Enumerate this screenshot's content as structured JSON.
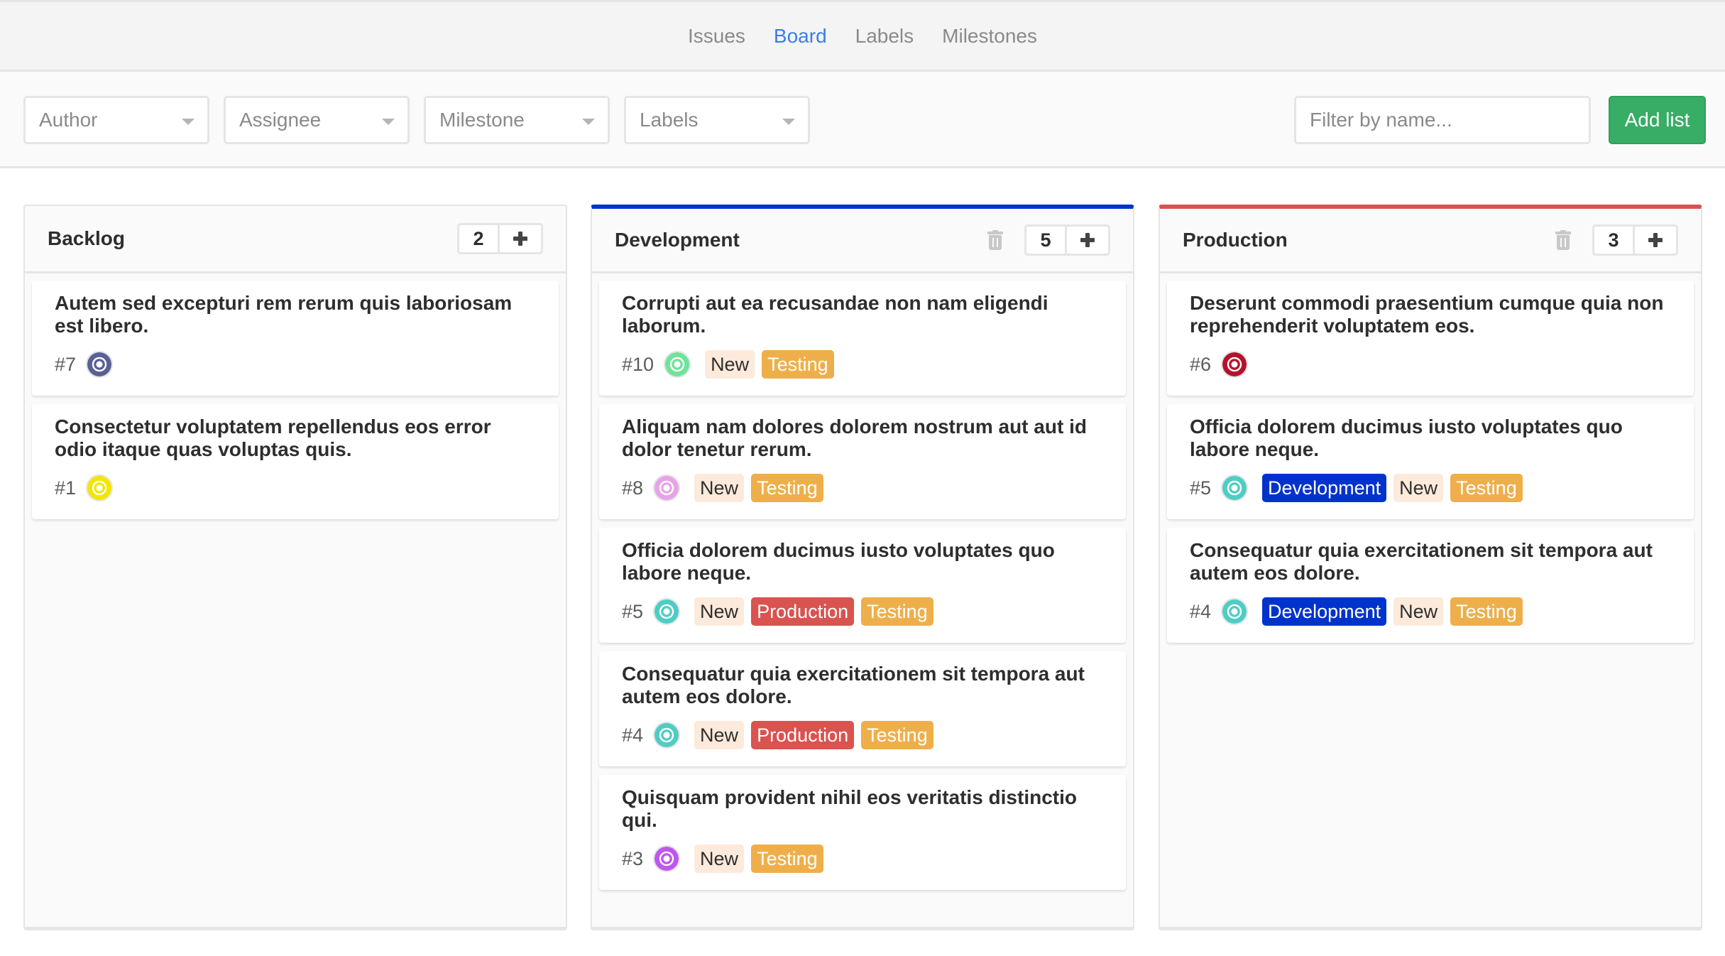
{
  "nav": {
    "items": [
      {
        "label": "Issues",
        "active": false
      },
      {
        "label": "Board",
        "active": true
      },
      {
        "label": "Labels",
        "active": false
      },
      {
        "label": "Milestones",
        "active": false
      }
    ]
  },
  "filters": {
    "author": "Author",
    "assignee": "Assignee",
    "milestone": "Milestone",
    "labels": "Labels",
    "search_placeholder": "Filter by name...",
    "search_value": "",
    "add_list_label": "Add list"
  },
  "colors": {
    "accent_link": "#3b7ee6",
    "add_list": "#37ad65",
    "development": "#0033cc",
    "production": "#d9534f",
    "new_bg": "#fdeadb",
    "new_text": "#2e2e2e",
    "testing": "#eeaf4b"
  },
  "columns": [
    {
      "title": "Backlog",
      "count": "2",
      "accent": null,
      "deletable": false,
      "cards": [
        {
          "title": "Autem sed excepturi rem rerum quis laboriosam est libero.",
          "number": "#7",
          "avatar_color": "#5a5f96",
          "labels": []
        },
        {
          "title": "Consectetur voluptatem repellendus eos error odio itaque quas voluptas quis.",
          "number": "#1",
          "avatar_color": "#f2e600",
          "labels": []
        }
      ]
    },
    {
      "title": "Development",
      "count": "5",
      "accent": "#0033cc",
      "deletable": true,
      "cards": [
        {
          "title": "Corrupti aut ea recusandae non nam eligendi laborum.",
          "number": "#10",
          "avatar_color": "#6fe39a",
          "labels": [
            "New",
            "Testing"
          ]
        },
        {
          "title": "Aliquam nam dolores dolorem nostrum aut aut id dolor tenetur rerum.",
          "number": "#8",
          "avatar_color": "#e8a3e6",
          "labels": [
            "New",
            "Testing"
          ]
        },
        {
          "title": "Officia dolorem ducimus iusto voluptates quo labore neque.",
          "number": "#5",
          "avatar_color": "#4ecdc4",
          "labels": [
            "New",
            "Production",
            "Testing"
          ]
        },
        {
          "title": "Consequatur quia exercitationem sit tempora aut autem eos dolore.",
          "number": "#4",
          "avatar_color": "#4ecdc4",
          "labels": [
            "New",
            "Production",
            "Testing"
          ]
        },
        {
          "title": "Quisquam provident nihil eos veritatis distinctio qui.",
          "number": "#3",
          "avatar_color": "#c056f0",
          "labels": [
            "New",
            "Testing"
          ]
        }
      ]
    },
    {
      "title": "Production",
      "count": "3",
      "accent": "#d9534f",
      "deletable": true,
      "cards": [
        {
          "title": "Deserunt commodi praesentium cumque quia non reprehenderit voluptatem eos.",
          "number": "#6",
          "avatar_color": "#b5122c",
          "labels": []
        },
        {
          "title": "Officia dolorem ducimus iusto voluptates quo labore neque.",
          "number": "#5",
          "avatar_color": "#4ecdc4",
          "labels": [
            "Development",
            "New",
            "Testing"
          ]
        },
        {
          "title": "Consequatur quia exercitationem sit tempora aut autem eos dolore.",
          "number": "#4",
          "avatar_color": "#4ecdc4",
          "labels": [
            "Development",
            "New",
            "Testing"
          ]
        }
      ]
    }
  ]
}
